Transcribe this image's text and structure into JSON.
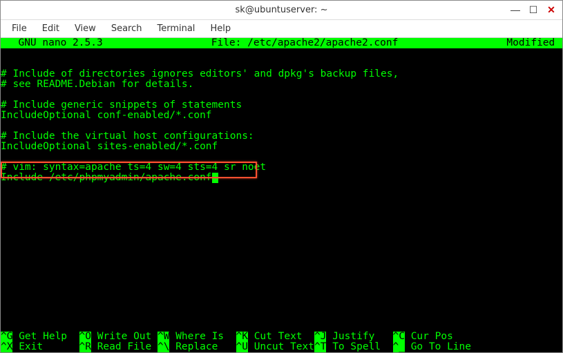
{
  "window": {
    "title": "sk@ubuntuserver: ~",
    "controls": {
      "minimize": "—",
      "maximize": "☐",
      "close": "✕"
    }
  },
  "menu": {
    "file": "File",
    "edit": "Edit",
    "view": "View",
    "search": "Search",
    "terminal": "Terminal",
    "help": "Help"
  },
  "nano": {
    "app": "  GNU nano 2.5.3",
    "file_label": "File: /etc/apache2/apache2.conf",
    "status": "Modified "
  },
  "content": {
    "l1": "# Include of directories ignores editors' and dpkg's backup files,",
    "l2": "# see README.Debian for details.",
    "l3": "# Include generic snippets of statements",
    "l4": "IncludeOptional conf-enabled/*.conf",
    "l5": "# Include the virtual host configurations:",
    "l6": "IncludeOptional sites-enabled/*.conf",
    "l7": "# vim: syntax=apache ts=4 sw=4 sts=4 sr noet",
    "l8": "Include /etc/phpmyadmin/apache.conf"
  },
  "shortcuts": {
    "r1": {
      "k1": "^G",
      "t1": " Get Help  ",
      "k2": "^O",
      "t2": " Write Out ",
      "k3": "^W",
      "t3": " Where Is  ",
      "k4": "^K",
      "t4": " Cut Text  ",
      "k5": "^J",
      "t5": " Justify   ",
      "k6": "^C",
      "t6": " Cur Pos"
    },
    "r2": {
      "k1": "^X",
      "t1": " Exit      ",
      "k2": "^R",
      "t2": " Read File ",
      "k3": "^\\",
      "t3": " Replace   ",
      "k4": "^U",
      "t4": " Uncut Text",
      "k5": "^T",
      "t5": " To Spell  ",
      "k6": "^_",
      "t6": " Go To Line"
    }
  }
}
